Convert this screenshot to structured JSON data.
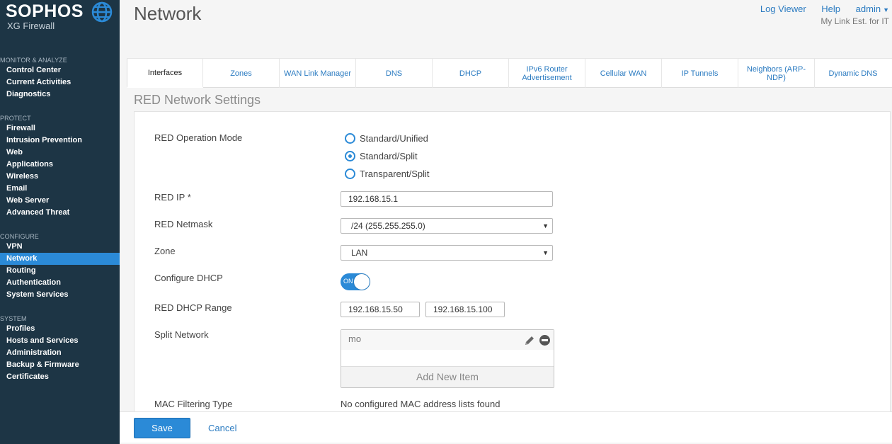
{
  "brand": {
    "name": "SOPHOS",
    "product": "XG Firewall"
  },
  "header": {
    "title": "Network",
    "links": {
      "log_viewer": "Log Viewer",
      "help": "Help",
      "admin": "admin"
    },
    "subtitle": "My Link Est. for IT"
  },
  "sidebar": {
    "sections": {
      "monitor": "MONITOR & ANALYZE",
      "protect": "PROTECT",
      "configure": "CONFIGURE",
      "system": "SYSTEM"
    },
    "items": {
      "control_center": "Control Center",
      "current_activities": "Current Activities",
      "diagnostics": "Diagnostics",
      "firewall": "Firewall",
      "intrusion_prevention": "Intrusion Prevention",
      "web": "Web",
      "applications": "Applications",
      "wireless": "Wireless",
      "email": "Email",
      "web_server": "Web Server",
      "advanced_threat": "Advanced Threat",
      "vpn": "VPN",
      "network": "Network",
      "routing": "Routing",
      "authentication": "Authentication",
      "system_services": "System Services",
      "profiles": "Profiles",
      "hosts_and_services": "Hosts and Services",
      "administration": "Administration",
      "backup_firmware": "Backup & Firmware",
      "certificates": "Certificates"
    },
    "active": "Network"
  },
  "tabs": {
    "interfaces": "Interfaces",
    "zones": "Zones",
    "wan_link_manager": "WAN Link Manager",
    "dns": "DNS",
    "dhcp": "DHCP",
    "ipv6_router": "IPv6 Router Advertisement",
    "cellular_wan": "Cellular WAN",
    "ip_tunnels": "IP Tunnels",
    "neighbors": "Neighbors (ARP-NDP)",
    "dynamic_dns": "Dynamic DNS",
    "active": "Interfaces"
  },
  "form": {
    "section_title": "RED Network Settings",
    "operation_mode": {
      "label": "RED Operation Mode",
      "options": {
        "standard_unified": "Standard/Unified",
        "standard_split": "Standard/Split",
        "transparent_split": "Transparent/Split"
      },
      "selected": "Standard/Split"
    },
    "red_ip": {
      "label": "RED IP *",
      "value": "192.168.15.1"
    },
    "red_netmask": {
      "label": "RED Netmask",
      "value": "/24 (255.255.255.0)"
    },
    "zone": {
      "label": "Zone",
      "value": "LAN"
    },
    "configure_dhcp": {
      "label": "Configure DHCP",
      "state": "ON"
    },
    "dhcp_range": {
      "label": "RED DHCP Range",
      "start": "192.168.15.50",
      "end": "192.168.15.100"
    },
    "split_network": {
      "label": "Split Network",
      "item": "mo",
      "add_label": "Add New Item"
    },
    "mac_filtering": {
      "label": "MAC Filtering Type",
      "value": "No configured MAC address lists found"
    }
  },
  "footer": {
    "save": "Save",
    "cancel": "Cancel"
  },
  "colors": {
    "sidebar_bg": "#1d3545",
    "accent": "#2b8ad7",
    "link": "#2b7bc1"
  }
}
